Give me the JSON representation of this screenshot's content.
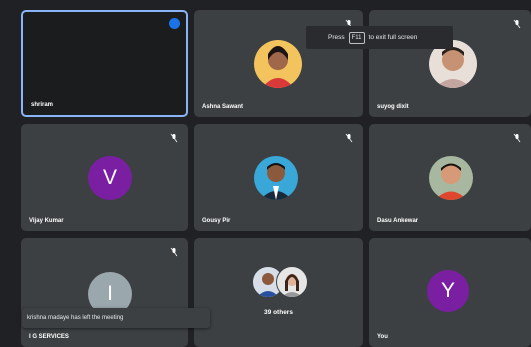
{
  "tiles": [
    {
      "name": "shriram",
      "kind": "video-off",
      "speaking": true
    },
    {
      "name": "Ashna Sawant",
      "kind": "photo"
    },
    {
      "name": "suyog dixit",
      "kind": "photo"
    },
    {
      "name": "Vijay Kumar",
      "kind": "letter",
      "letter": "V",
      "color": "#7b1fa2"
    },
    {
      "name": "Gousy Pir",
      "kind": "photo"
    },
    {
      "name": "Dasu Ankewar",
      "kind": "photo"
    },
    {
      "name": "I G SERVICES",
      "kind": "letter",
      "letter": "I",
      "color": "#9aa7ad"
    },
    {
      "name": "39 others",
      "kind": "group"
    },
    {
      "name": "You",
      "kind": "letter",
      "letter": "Y",
      "color": "#7b1fa2"
    }
  ],
  "notification": {
    "text": "krishna madaye has left the meeting"
  },
  "fullscreen_hint": {
    "press": "Press",
    "key": "F11",
    "suffix": "to exit full screen"
  },
  "colors": {
    "background": "#202124",
    "tile": "#3c4043",
    "speaking_border": "#8ab4f8",
    "badge": "#1a73e8"
  }
}
